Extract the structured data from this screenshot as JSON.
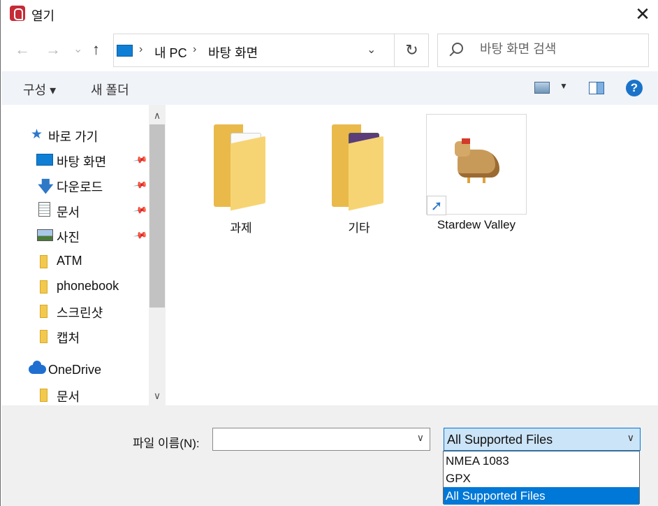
{
  "window": {
    "title": "열기",
    "close": "✕"
  },
  "navigation": {
    "back": "←",
    "forward": "→",
    "recent": "⌄",
    "up": "↑"
  },
  "address": {
    "breadcrumb": [
      "내 PC",
      "바탕 화면"
    ],
    "separator": "›",
    "dropdown": "⌄",
    "refresh": "↻"
  },
  "search": {
    "placeholder": "바탕 화면 검색"
  },
  "toolbar": {
    "organize": "구성 ▾",
    "new_folder": "새 폴더",
    "view_dropdown": "▼",
    "help": "?"
  },
  "sidebar": {
    "quick_access": "바로 가기",
    "items": [
      {
        "label": "바탕 화면",
        "icon": "desktop-icon",
        "pinned": true
      },
      {
        "label": "다운로드",
        "icon": "download-icon",
        "pinned": true
      },
      {
        "label": "문서",
        "icon": "document-icon",
        "pinned": true
      },
      {
        "label": "사진",
        "icon": "picture-icon",
        "pinned": true
      },
      {
        "label": "ATM",
        "icon": "folder-icon",
        "pinned": false
      },
      {
        "label": "phonebook",
        "icon": "folder-icon",
        "pinned": false
      },
      {
        "label": "스크린샷",
        "icon": "folder-icon",
        "pinned": false
      },
      {
        "label": "캡처",
        "icon": "folder-icon",
        "pinned": false
      }
    ],
    "onedrive": "OneDrive",
    "onedrive_items": [
      {
        "label": "문서",
        "icon": "folder-icon"
      }
    ],
    "pin_glyph": "📌",
    "scroll_up": "∧",
    "scroll_down": "∨"
  },
  "files": [
    {
      "name": "과제",
      "type": "folder"
    },
    {
      "name": "기타",
      "type": "folder"
    },
    {
      "name": "Stardew Valley",
      "type": "shortcut"
    }
  ],
  "footer": {
    "filename_label": "파일 이름(N):",
    "filename_value": "",
    "filename_dropdown": "∨",
    "filetype_selected": "All Supported Files",
    "filetype_dropdown": "∨",
    "filetype_options": [
      "NMEA 1083",
      "GPX",
      "All Supported Files"
    ]
  },
  "colors": {
    "accent": "#0078d7",
    "toolbar_bg": "#f0f3f8",
    "footer_bg": "#f0f0f0",
    "selection_bg": "#cce4f7"
  }
}
